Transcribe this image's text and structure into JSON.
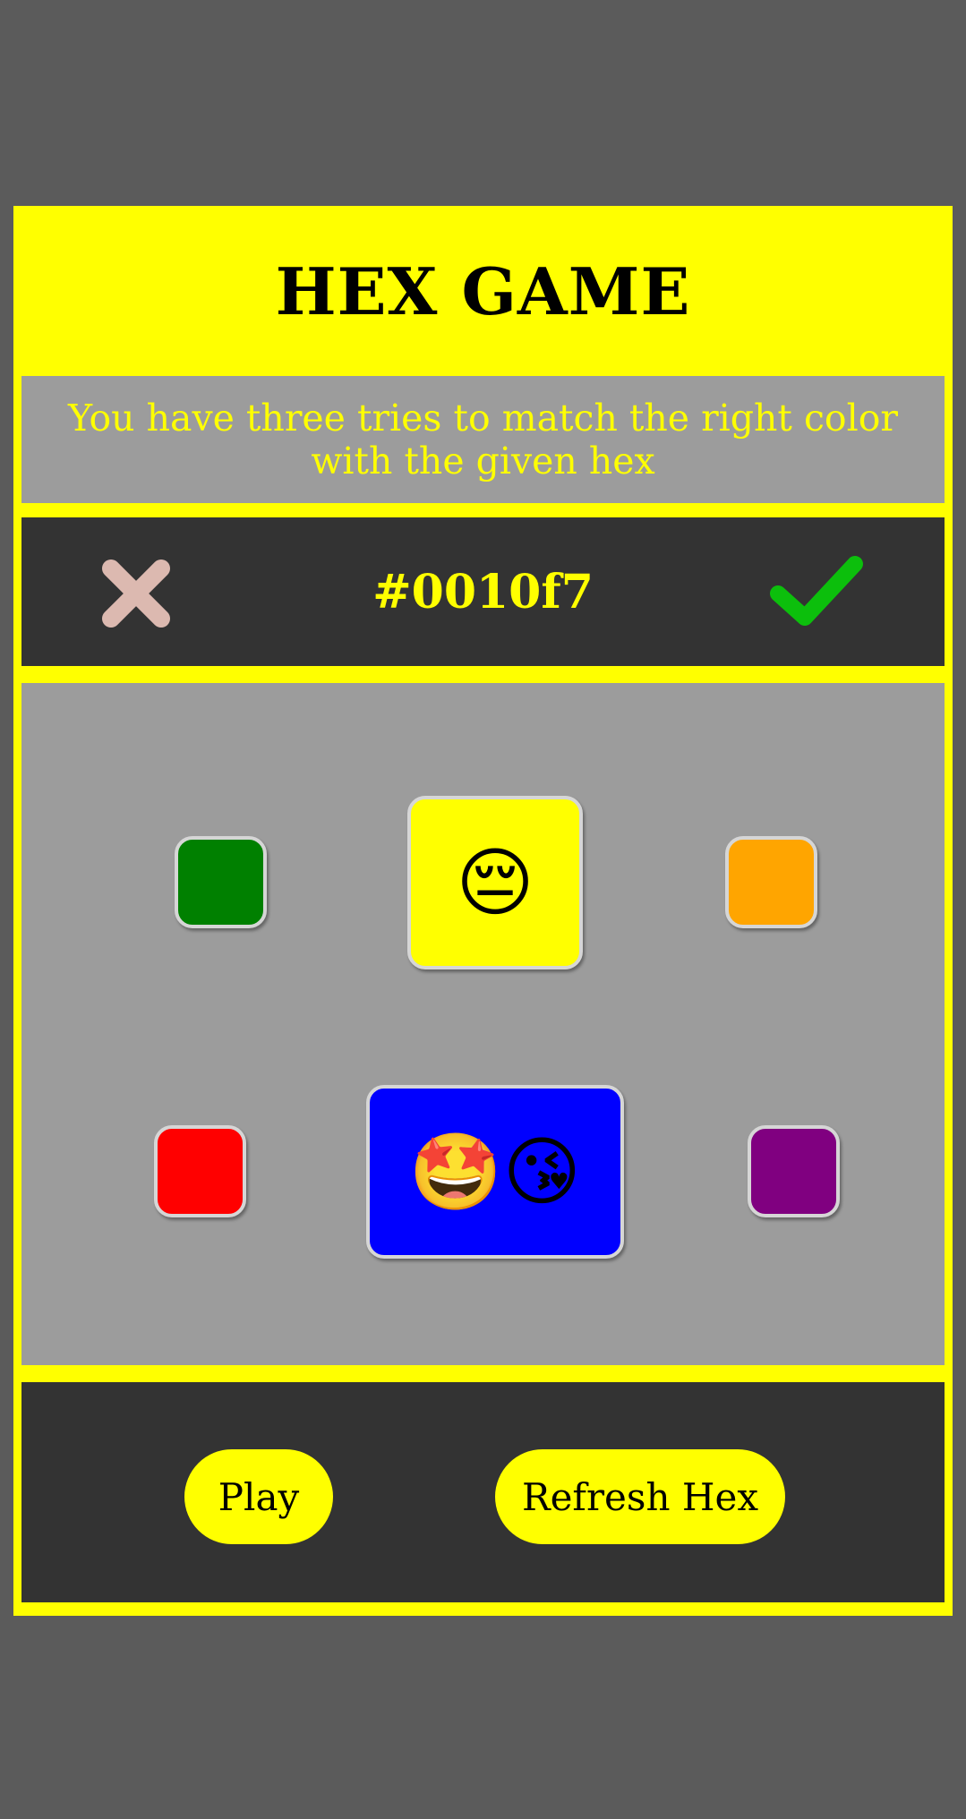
{
  "title": "HEX GAME",
  "instructions": "You have three tries to match the right color with the given hex",
  "hex_bar": {
    "target_hex": "#0010f7",
    "fail_icon": "x-mark-icon",
    "success_icon": "checkmark-icon"
  },
  "colors": {
    "background": "#5b5b5b",
    "accent": "#ffff00",
    "panel_dark": "#333333",
    "panel_light": "#9c9c9c",
    "fail_icon": "#dcb9b0",
    "success_icon": "#0cbf0c"
  },
  "board": {
    "swatches": [
      {
        "name": "green",
        "color": "#008000",
        "emoji": ""
      },
      {
        "name": "yellow",
        "color": "#ffff00",
        "emoji": "😔"
      },
      {
        "name": "orange",
        "color": "#ffa500",
        "emoji": ""
      },
      {
        "name": "red",
        "color": "#ff0000",
        "emoji": ""
      },
      {
        "name": "blue",
        "color": "#0000ff",
        "emoji": "🤩😘"
      },
      {
        "name": "purple",
        "color": "#800080",
        "emoji": ""
      }
    ]
  },
  "controls": {
    "play_label": "Play",
    "refresh_label": "Refresh Hex"
  }
}
